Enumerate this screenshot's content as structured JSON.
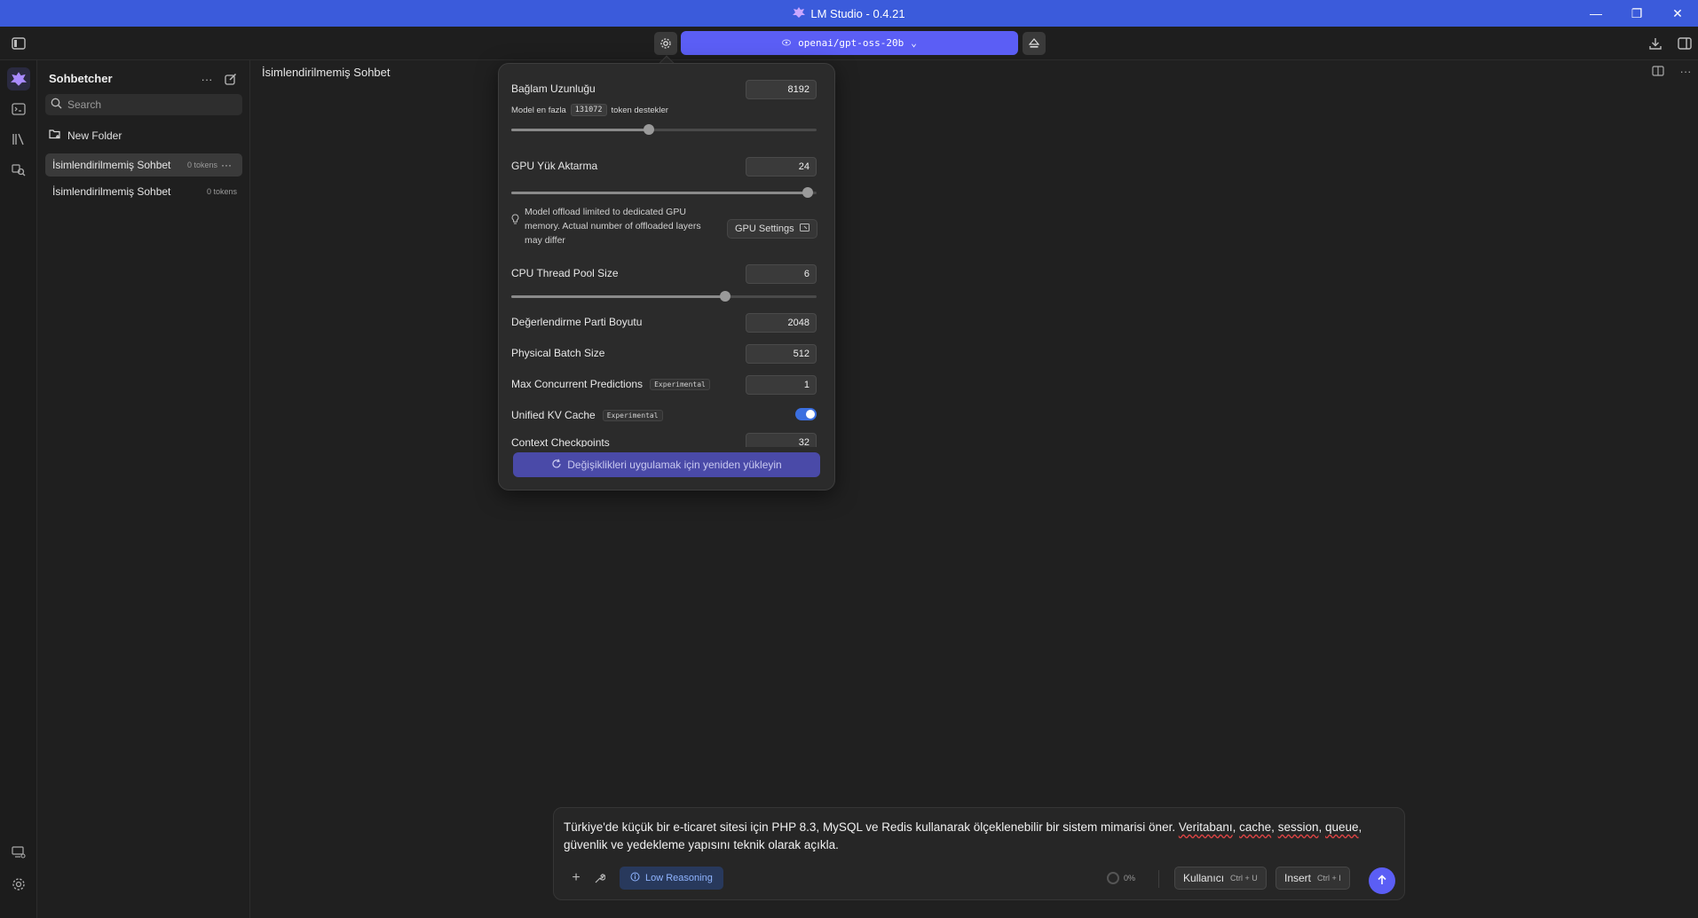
{
  "window": {
    "title": "LM Studio - 0.4.21"
  },
  "toolbar": {
    "model": "openai/gpt-oss-20b"
  },
  "sidebar": {
    "title": "Sohbetcher",
    "search_placeholder": "Search",
    "new_folder": "New Folder",
    "chats": [
      {
        "name": "İsimlendirilmemiş Sohbet",
        "tokens": "0 tokens",
        "active": true
      },
      {
        "name": "İsimlendirilmemiş Sohbet",
        "tokens": "0 tokens",
        "active": false
      }
    ]
  },
  "main": {
    "title": "İsimlendirilmemiş Sohbet"
  },
  "settings": {
    "context_length": {
      "label": "Bağlam Uzunluğu",
      "value": "8192",
      "note_prefix": "Model en fazla",
      "note_max": "131072",
      "note_suffix": "token destekler",
      "slider": 0.45
    },
    "gpu_offload": {
      "label": "GPU Yük Aktarma",
      "value": "24",
      "slider": 0.97
    },
    "gpu_note": "Model offload limited to dedicated GPU memory. Actual number of offloaded layers may differ",
    "gpu_settings": "GPU Settings",
    "cpu_threads": {
      "label": "CPU Thread Pool Size",
      "value": "6",
      "slider": 0.7
    },
    "eval_batch": {
      "label": "Değerlendirme Parti Boyutu",
      "value": "2048"
    },
    "physical_batch": {
      "label": "Physical Batch Size",
      "value": "512"
    },
    "max_concurrent": {
      "label": "Max Concurrent Predictions",
      "value": "1",
      "tag": "Experimental"
    },
    "unified_kv": {
      "label": "Unified KV Cache",
      "tag": "Experimental",
      "enabled": true
    },
    "context_checkpoints": {
      "label": "Context Checkpoints",
      "value": "32"
    },
    "reload_button": "Değişiklikleri uygulamak için yeniden yükleyin"
  },
  "composer": {
    "text_before": "Türkiye'de küçük bir e-ticaret sitesi için PHP 8.3, MySQL ve Redis kullanarak ölçeklenebilir bir sistem mimarisi öner. ",
    "text_w1": "Veritabanı",
    "text_m1": ", ",
    "text_w2": "cache",
    "text_m2": ", ",
    "text_w3": "session",
    "text_m3": ", ",
    "text_w4": "queue",
    "text_after": ", güvenlik ve yedekleme yapısını teknik olarak açıkla.",
    "reasoning": "Low Reasoning",
    "context_usage": "0%",
    "role_button": "Kullanıcı",
    "role_shortcut": "Ctrl + U",
    "insert_button": "Insert",
    "insert_shortcut": "Ctrl + I"
  },
  "colors": {
    "titlebar": "#3b5bdb",
    "accent": "#5b5ef5",
    "background": "#202020"
  }
}
